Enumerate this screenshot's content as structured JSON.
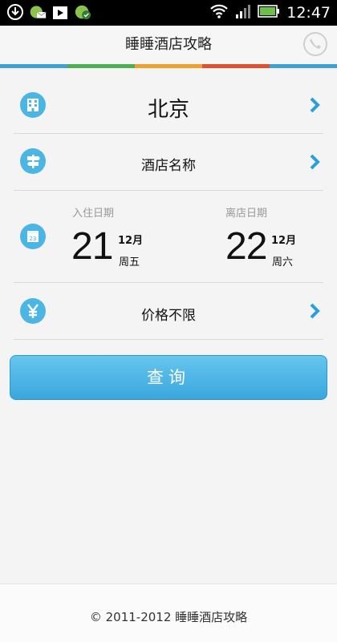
{
  "status_bar": {
    "time": "12:47"
  },
  "header": {
    "title": "睡睡酒店攻略"
  },
  "city": {
    "label": "北京"
  },
  "hotel": {
    "label": "酒店名称"
  },
  "checkin": {
    "label": "入住日期",
    "day": "21",
    "month": "12月",
    "weekday": "周五"
  },
  "checkout": {
    "label": "离店日期",
    "day": "22",
    "month": "12月",
    "weekday": "周六"
  },
  "price": {
    "label": "价格不限"
  },
  "calendar_icon_day": "23",
  "query_button": {
    "label": "查询"
  },
  "footer": {
    "text": "© 2011-2012 睡睡酒店攻略"
  },
  "colors": {
    "accent": "#4bb6e4",
    "header_bar": [
      "#3fa0d8",
      "#4caf50",
      "#f0a030",
      "#e05030",
      "#3fa0d8"
    ]
  },
  "icons": [
    "building-icon",
    "signpost-icon",
    "calendar-icon",
    "yen-icon",
    "chevron-right-icon",
    "phone-icon"
  ]
}
